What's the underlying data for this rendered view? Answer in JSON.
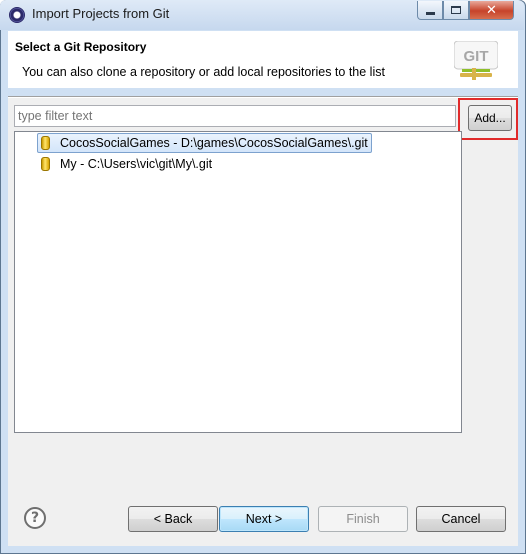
{
  "window": {
    "title": "Import Projects from Git",
    "minimize_label": "",
    "maximize_label": "",
    "close_label": "✕"
  },
  "header": {
    "title": "Select a Git Repository",
    "description": "You can also clone a repository or add local repositories to the list",
    "logo_text": "GIT"
  },
  "filter": {
    "placeholder": "type filter text",
    "value": ""
  },
  "add_button": {
    "label": "Add..."
  },
  "repositories": [
    {
      "label": "CocosSocialGames - D:\\games\\CocosSocialGames\\.git",
      "selected": true,
      "icon": "repository-icon"
    },
    {
      "label": "My - C:\\Users\\vic\\git\\My\\.git",
      "selected": false,
      "icon": "repository-icon"
    }
  ],
  "footer": {
    "help_label": "?",
    "back_label": "< Back",
    "next_label": "Next >",
    "finish_label": "Finish",
    "cancel_label": "Cancel"
  },
  "colors": {
    "highlight_box": "#e12b2b",
    "selection_border": "#7da2ce",
    "repository_icon": "#e8b80f"
  }
}
